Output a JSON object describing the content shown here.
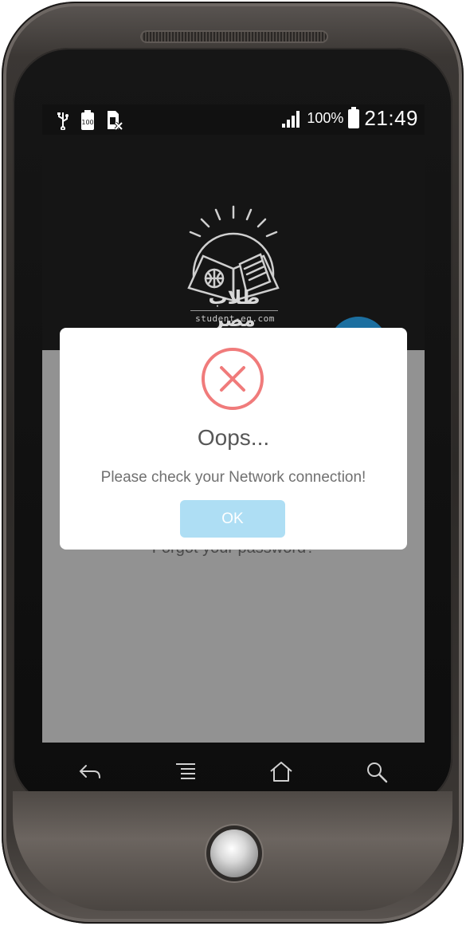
{
  "status_bar": {
    "battery_percent": "100%",
    "time": "21:49",
    "left_icons": [
      "usb-icon",
      "battery-100-icon",
      "sim-missing-icon"
    ],
    "right_icons": [
      "signal-icon",
      "battery-icon"
    ]
  },
  "app": {
    "logo_arabic": "طلاب مصر",
    "logo_site": "student-eg.com",
    "forgot_password": "Forgot your password?"
  },
  "dialog": {
    "icon": "error-x-icon",
    "title": "Oops...",
    "message": "Please check your Network connection!",
    "ok_label": "OK",
    "colors": {
      "error": "#f07b7b",
      "ok_button": "#aedef4"
    }
  },
  "nav": {
    "icons": [
      "back-icon",
      "menu-icon",
      "home-icon",
      "search-icon"
    ]
  }
}
